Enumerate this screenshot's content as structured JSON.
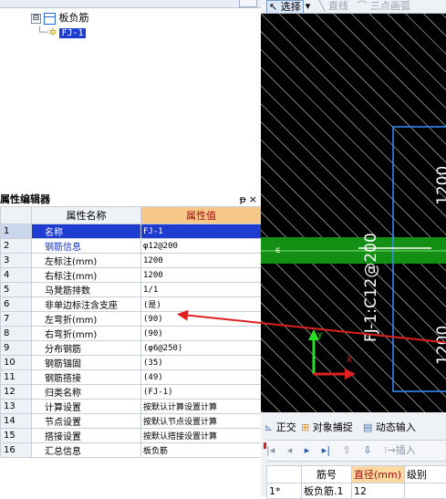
{
  "tree": {
    "root_label": "板负筋",
    "child_label": "FJ-1",
    "toggle": "⊟"
  },
  "panel": {
    "title": "属性编辑器",
    "pin": "ᵽ",
    "close": "×",
    "columns": [
      "属性名称",
      "属性值"
    ],
    "rows": [
      {
        "n": "1",
        "name": "名称",
        "value": "FJ-1",
        "blue": true
      },
      {
        "n": "2",
        "name": "钢筋信息",
        "value": "φ12@200",
        "blue": true
      },
      {
        "n": "3",
        "name": "左标注(mm)",
        "value": "1200",
        "blue": false
      },
      {
        "n": "4",
        "name": "右标注(mm)",
        "value": "1200",
        "blue": false
      },
      {
        "n": "5",
        "name": "马凳筋排数",
        "value": "1/1",
        "blue": false
      },
      {
        "n": "6",
        "name": "非单边标注含支座",
        "value": "(是)",
        "blue": false
      },
      {
        "n": "7",
        "name": "左弯折(mm)",
        "value": "(90)",
        "blue": false
      },
      {
        "n": "8",
        "name": "右弯折(mm)",
        "value": "(90)",
        "blue": false
      },
      {
        "n": "9",
        "name": "分布钢筋",
        "value": "(φ6@250)",
        "blue": false
      },
      {
        "n": "10",
        "name": "钢筋锚固",
        "value": "(35)",
        "blue": false
      },
      {
        "n": "11",
        "name": "钢筋搭接",
        "value": "(49)",
        "blue": false
      },
      {
        "n": "12",
        "name": "归类名称",
        "value": "(FJ-1)",
        "blue": false
      },
      {
        "n": "13",
        "name": "计算设置",
        "value": "按默认计算设置计算",
        "blue": false
      },
      {
        "n": "14",
        "name": "节点设置",
        "value": "按默认节点设置计算",
        "blue": false
      },
      {
        "n": "15",
        "name": "搭接设置",
        "value": "按默认搭接设置计算",
        "blue": false
      },
      {
        "n": "16",
        "name": "汇总信息",
        "value": "板负筋",
        "blue": false
      }
    ]
  },
  "toolbar": {
    "select_label": "选择",
    "select_caret": "▾",
    "line_label": "直线",
    "arc_label": "三点画弧"
  },
  "drawing": {
    "label": "FJ-1:C12@200",
    "dim_partial": "1200",
    "dim_partial_right": "1200"
  },
  "bottom": {
    "tab_ortho": "正交",
    "tab_snap": "对象捕捉",
    "tab_dynamic": "动态输入",
    "nav_insert": "插入",
    "columns": [
      "",
      "筋号",
      "直径(mm)",
      "级别"
    ],
    "row1": [
      "1*",
      "板负筋.1",
      "12",
      ""
    ]
  }
}
